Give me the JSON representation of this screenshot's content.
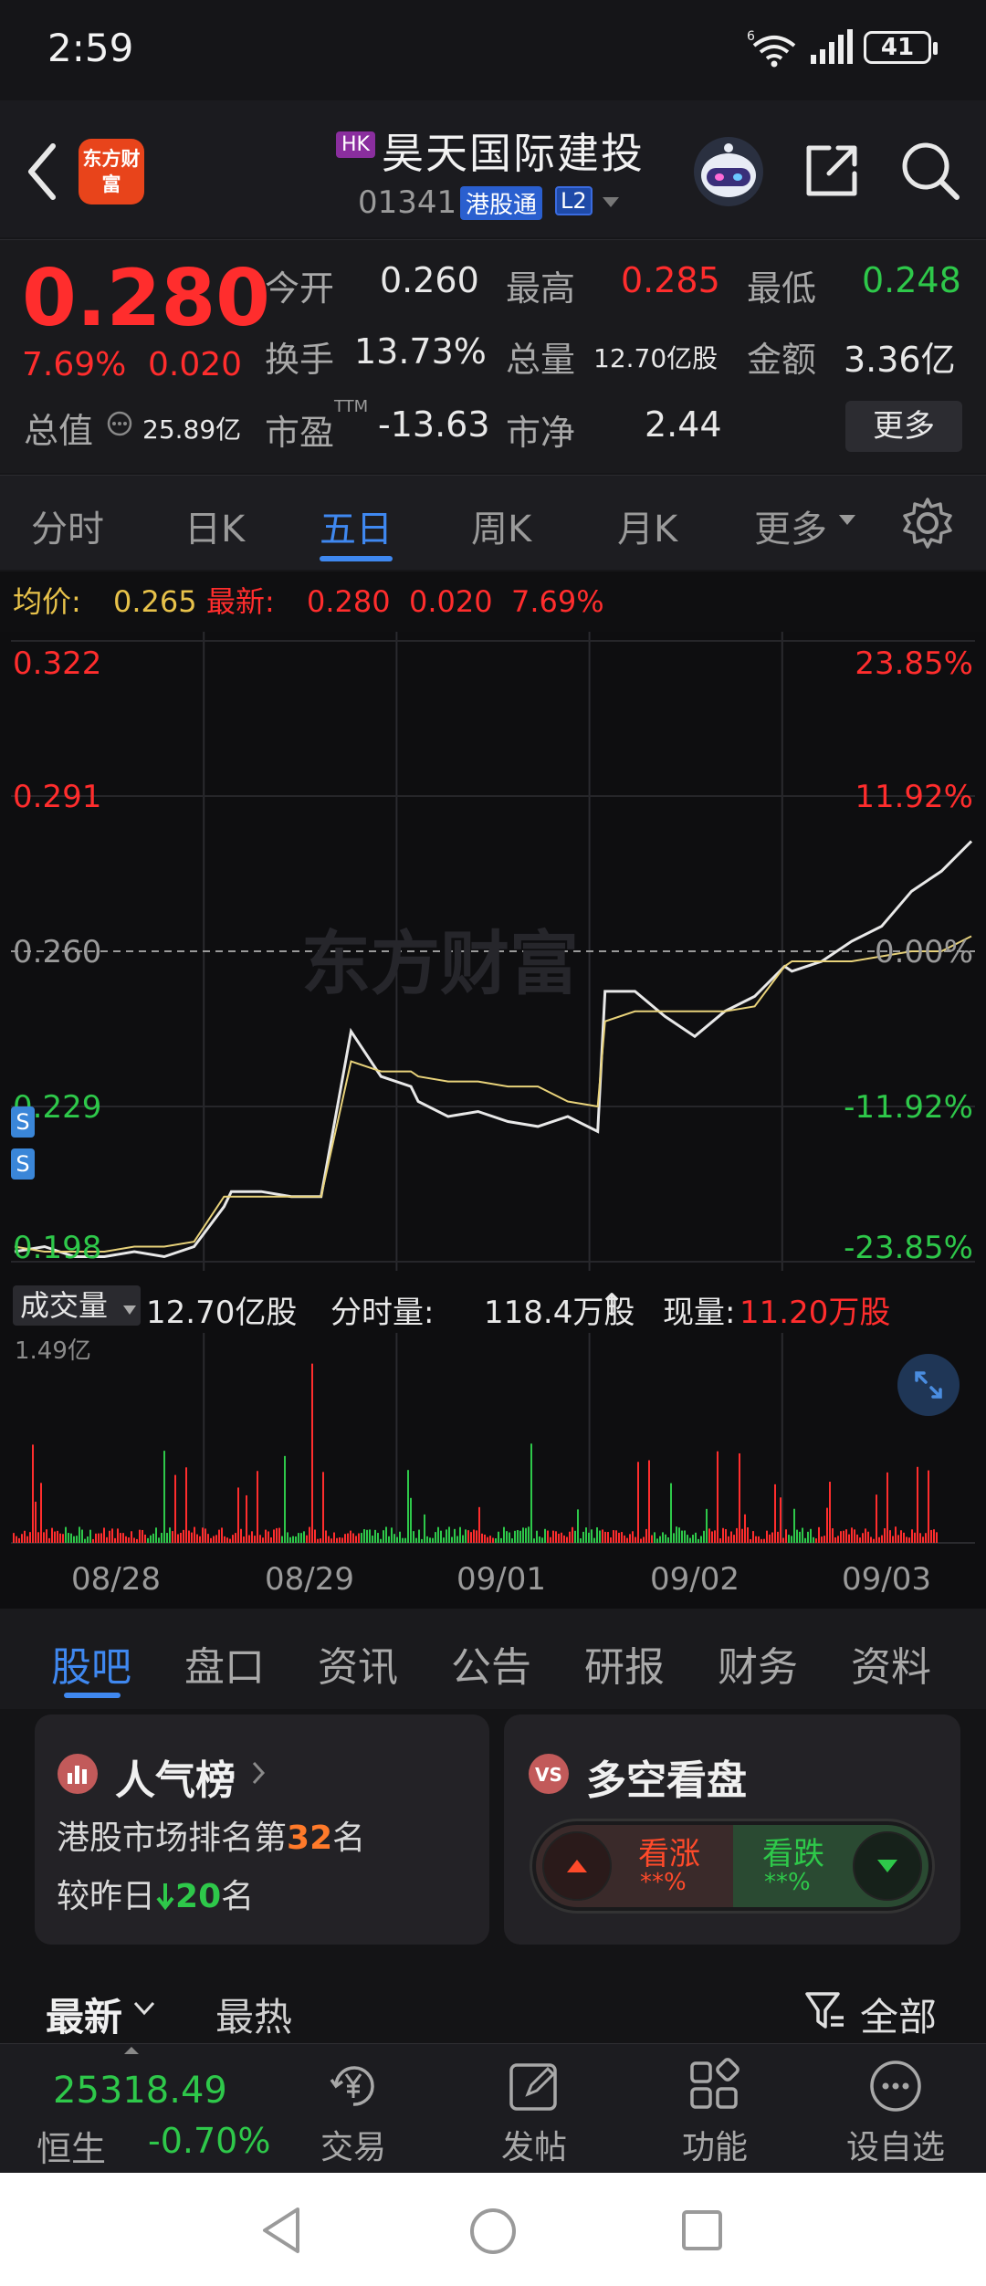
{
  "status_bar": {
    "time": "2:59",
    "battery": "41"
  },
  "header": {
    "logo_text": "东方财富",
    "market_badge": "HK",
    "name": "昊天国际建投",
    "code": "01341",
    "connect_badge": "港股通",
    "level_badge": "L2"
  },
  "quote": {
    "price": "0.280",
    "change_pct": "7.69%",
    "change_amt": "0.020",
    "open_label": "今开",
    "open": "0.260",
    "high_label": "最高",
    "high": "0.285",
    "low_label": "最低",
    "low": "0.248",
    "turnover_label": "换手",
    "turnover": "13.73%",
    "volume_label": "总量",
    "volume": "12.70亿股",
    "amount_label": "金额",
    "amount": "3.36亿",
    "mcap_label": "总值",
    "mcap": "25.89亿",
    "pe_label": "市盈",
    "pe_sup": "TTM",
    "pe": "-13.63",
    "pb_label": "市净",
    "pb": "2.44",
    "more_label": "更多"
  },
  "chart_tabs": {
    "t0": "分时",
    "t1": "日K",
    "t2": "五日",
    "t3": "周K",
    "t4": "月K",
    "t5": "更多"
  },
  "chart_header": {
    "avg_label": "均价:",
    "avg": "0.265",
    "last_label": "最新:",
    "last": "0.280",
    "chg": "0.020",
    "pct": "7.69%"
  },
  "chart_data": {
    "type": "line",
    "title": "",
    "x": [
      "08/28",
      "08/29",
      "09/01",
      "09/02",
      "09/03"
    ],
    "price_ticks": [
      "0.322",
      "0.291",
      "0.260",
      "0.229",
      "0.198"
    ],
    "pct_ticks": [
      "23.85%",
      "11.92%",
      "0.00%",
      "-11.92%",
      "-23.85%"
    ],
    "ylim": [
      0.198,
      0.322
    ],
    "reference": 0.26,
    "series": [
      {
        "values": [
          0.2,
          0.201,
          0.199,
          0.199,
          0.2,
          0.199,
          0.201,
          0.209,
          0.212,
          0.212,
          0.211,
          0.211,
          0.244,
          0.235,
          0.233,
          0.23,
          0.227,
          0.228,
          0.226,
          0.225,
          0.227,
          0.224,
          0.252,
          0.252,
          0.247,
          0.243,
          0.248,
          0.251,
          0.257,
          0.256,
          0.258,
          0.262,
          0.265,
          0.272,
          0.276,
          0.282
        ]
      },
      {
        "values": [
          0.201,
          0.2,
          0.2,
          0.2,
          0.201,
          0.201,
          0.202,
          0.211,
          0.211,
          0.211,
          0.211,
          0.211,
          0.238,
          0.236,
          0.236,
          0.235,
          0.234,
          0.234,
          0.233,
          0.233,
          0.23,
          0.229,
          0.246,
          0.248,
          0.248,
          0.248,
          0.248,
          0.249,
          0.257,
          0.258,
          0.258,
          0.258,
          0.259,
          0.26,
          0.26,
          0.263
        ]
      }
    ],
    "volume_max": "1.49亿"
  },
  "volume_header": {
    "label": "成交量",
    "total": "12.70亿股",
    "tick_label": "分时量:",
    "tick": "118.4万股",
    "arrow": "↑",
    "now_label": "现量:",
    "now": "11.20万股"
  },
  "section_tabs": {
    "s0": "股吧",
    "s1": "盘口",
    "s2": "资讯",
    "s3": "公告",
    "s4": "研报",
    "s5": "财务",
    "s6": "资料"
  },
  "popularity": {
    "title": "人气榜",
    "line1_pre": "港股市场排名第",
    "rank": "32",
    "line1_post": "名",
    "line2_pre": "较昨日",
    "delta": "20",
    "line2_post": "名"
  },
  "sentiment": {
    "title": "多空看盘",
    "bull_label": "看涨",
    "bull_pct": "**%",
    "bear_label": "看跌",
    "bear_pct": "**%"
  },
  "sort_row": {
    "latest": "最新",
    "hot": "最热",
    "filter": "全部"
  },
  "bottom_nav": {
    "index_value": "25318.49",
    "index_name": "恒生",
    "index_change": "-0.70%",
    "trade": "交易",
    "post": "发帖",
    "functions": "功能",
    "watch": "设自选"
  },
  "colors": {
    "up": "#ff2d2d",
    "down": "#2ec84a",
    "accent": "#3f88f0",
    "avg_line": "#e8d27a"
  }
}
